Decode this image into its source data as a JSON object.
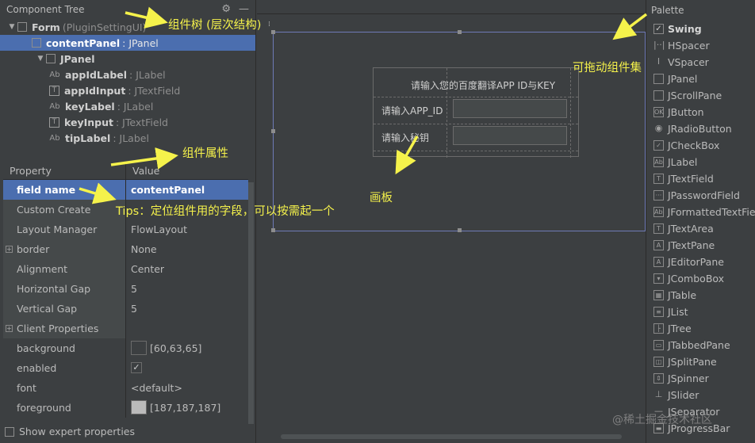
{
  "component_tree": {
    "title": "Component Tree",
    "items": [
      {
        "name": "Form",
        "type": "(PluginSettingUI)",
        "depth": 0,
        "expanded": true,
        "selected": false
      },
      {
        "name": "contentPanel",
        "type": ": JPanel",
        "depth": 1,
        "expanded": false,
        "selected": true
      },
      {
        "name": "JPanel",
        "type": "",
        "depth": 2,
        "expanded": true,
        "selected": false
      },
      {
        "name": "appIdLabel",
        "type": ": JLabel",
        "depth": 3,
        "icon": "Ab",
        "selected": false
      },
      {
        "name": "appIdInput",
        "type": ": JTextField",
        "depth": 3,
        "icon": "T",
        "selected": false
      },
      {
        "name": "keyLabel",
        "type": ": JLabel",
        "depth": 3,
        "icon": "Ab",
        "selected": false
      },
      {
        "name": "keyInput",
        "type": ": JTextField",
        "depth": 3,
        "icon": "T",
        "selected": false
      },
      {
        "name": "tipLabel",
        "type": ": JLabel",
        "depth": 3,
        "icon": "Ab",
        "selected": false
      }
    ]
  },
  "properties": {
    "header_property": "Property",
    "header_value": "Value",
    "rows": [
      {
        "name": "field name",
        "value": "contentPanel",
        "selected": true
      },
      {
        "name": "Custom Create",
        "value": ""
      },
      {
        "name": "Layout Manager",
        "value": "FlowLayout"
      },
      {
        "name": "border",
        "value": "None",
        "expandable": true
      },
      {
        "name": "Alignment",
        "value": "Center"
      },
      {
        "name": "Horizontal Gap",
        "value": "5"
      },
      {
        "name": "Vertical Gap",
        "value": "5"
      },
      {
        "name": "Client Properties",
        "value": "",
        "expandable": true
      },
      {
        "name": "background",
        "value": "[60,63,65]",
        "swatch": "#3c3f41"
      },
      {
        "name": "enabled",
        "value": "",
        "checked": true
      },
      {
        "name": "font",
        "value": "<default>"
      },
      {
        "name": "foreground",
        "value": "[187,187,187]",
        "swatch": "#bbbbbb"
      }
    ],
    "expert_label": "Show expert properties"
  },
  "canvas": {
    "form_title": "请输入您的百度翻译APP ID与KEY",
    "label_appid": "请输入APP_ID",
    "label_key": "请输入秘钥"
  },
  "palette": {
    "title": "Palette",
    "group": "Swing",
    "items": [
      {
        "label": "HSpacer",
        "icon": "|··|"
      },
      {
        "label": "VSpacer",
        "icon": "I"
      },
      {
        "label": "JPanel",
        "icon": ""
      },
      {
        "label": "JScrollPane",
        "icon": ""
      },
      {
        "label": "JButton",
        "icon": "OK"
      },
      {
        "label": "JRadioButton",
        "icon": "◉"
      },
      {
        "label": "JCheckBox",
        "icon": "✓"
      },
      {
        "label": "JLabel",
        "icon": "Ab"
      },
      {
        "label": "JTextField",
        "icon": "T"
      },
      {
        "label": "JPasswordField",
        "icon": "···"
      },
      {
        "label": "JFormattedTextField",
        "icon": "Ab"
      },
      {
        "label": "JTextArea",
        "icon": "T"
      },
      {
        "label": "JTextPane",
        "icon": "A"
      },
      {
        "label": "JEditorPane",
        "icon": "A"
      },
      {
        "label": "JComboBox",
        "icon": "▾"
      },
      {
        "label": "JTable",
        "icon": "▦"
      },
      {
        "label": "JList",
        "icon": "≡"
      },
      {
        "label": "JTree",
        "icon": "├"
      },
      {
        "label": "JTabbedPane",
        "icon": "▭"
      },
      {
        "label": "JSplitPane",
        "icon": "◫"
      },
      {
        "label": "JSpinner",
        "icon": "⇕"
      },
      {
        "label": "JSlider",
        "icon": "⊥"
      },
      {
        "label": "JSeparator",
        "icon": "—"
      },
      {
        "label": "JProgressBar",
        "icon": "▬"
      }
    ]
  },
  "annotations": {
    "tree_note": "组件树 (层次结构)",
    "props_note": "组件属性",
    "tips_note": "Tips：定位组件用的字段，可以按需起一个",
    "palette_note": "可拖动组件集",
    "canvas_note": "画板"
  },
  "watermark": "@稀土掘金技术社区",
  "colors": {
    "selection": "#4b6eaf",
    "annotation": "#f5f24b",
    "background": "#3c3f41"
  }
}
